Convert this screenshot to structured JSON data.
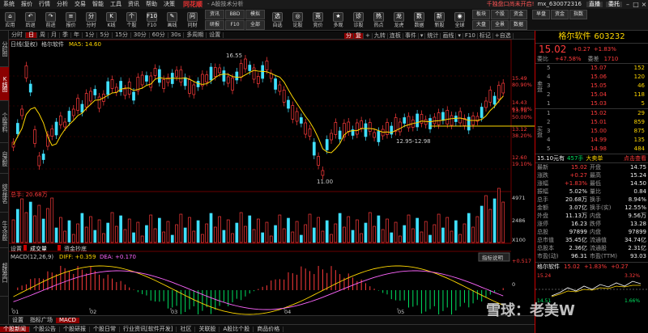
{
  "menubar": {
    "items": [
      "系统",
      "报价",
      "行情",
      "分析",
      "交易",
      "智能",
      "工具",
      "资讯",
      "帮助",
      "决策"
    ],
    "logo": "同花顺",
    "title": "- A股技术分析",
    "promo": "千独盘口尚未开启!",
    "account": "mx_630072316",
    "live": "直播",
    "delegate": "委托"
  },
  "toolbar": {
    "items": [
      {
        "icon": "⌂",
        "label": "应用"
      },
      {
        "icon": "↶",
        "label": "后退"
      },
      {
        "icon": "↷",
        "label": "前进"
      },
      {
        "icon": "≡",
        "label": "报价"
      },
      {
        "icon": "分",
        "label": "分时"
      },
      {
        "icon": "K",
        "label": "K线"
      },
      {
        "icon": "个",
        "label": "个股"
      },
      {
        "icon": "F10",
        "label": "F10"
      },
      {
        "icon": "✎",
        "label": "画线"
      },
      {
        "icon": "问",
        "label": "问财"
      },
      {
        "icon": "选",
        "label": "自选"
      },
      {
        "icon": "◎",
        "label": "论股"
      },
      {
        "icon": "竞",
        "label": "竞价"
      },
      {
        "icon": "★",
        "label": "多观"
      },
      {
        "icon": "诊",
        "label": "诊股"
      },
      {
        "icon": "热",
        "label": "热点"
      },
      {
        "icon": "龙",
        "label": "龙虎"
      },
      {
        "icon": "数",
        "label": "数据"
      },
      {
        "icon": "新",
        "label": "新股"
      },
      {
        "icon": "◉",
        "label": "全球"
      }
    ],
    "small": [
      "资讯",
      "BBD",
      "模拟",
      "研报",
      "F10",
      "全部",
      "早盘",
      "资金",
      "指数"
    ],
    "extra": [
      "板块",
      "个股",
      "资金",
      "大盘",
      "全景",
      "数据"
    ]
  },
  "lefttabs": [
    "分时图",
    "K线图",
    "个股资料",
    "自选股",
    "综合排名",
    "牛叉诊股",
    "超级盘口"
  ],
  "periodbar": {
    "items": [
      "分时",
      "日",
      "周",
      "月",
      "季",
      "年",
      "1分",
      "5分",
      "15分",
      "30分",
      "60分",
      "30s",
      "多周期",
      "设置"
    ],
    "active": "日",
    "extra": [
      "分",
      "复",
      "+",
      "九转",
      "连板",
      "事件",
      "▾",
      "统计",
      "画线",
      "▾",
      "F10",
      "标记",
      "+自选"
    ]
  },
  "mainchart": {
    "label": "日线(复权)",
    "stock": "格尔软件",
    "ma": "MA5: 14.60",
    "price_labels": [
      "15.49",
      "14.43",
      "13.78",
      "13.12",
      "12.60"
    ],
    "pct_labels": [
      "80.90%",
      "61.80%",
      "50.00%",
      "38.20%",
      "19.10%"
    ],
    "annotations": {
      "high": "16.55",
      "low": "11.00",
      "range": "12.95-12.98"
    }
  },
  "volchart": {
    "label": "总手: 20.68万",
    "ticks": [
      "4971",
      "2486",
      "X100"
    ],
    "tabs": [
      "设置",
      "成交量",
      "资金抄底"
    ]
  },
  "macdchart": {
    "label": "MACD(12,26,9)",
    "diff": "DIFF: +0.359",
    "dea": "DEA: +0.170",
    "ticks": [
      "+0.517",
      "0",
      "-0.517"
    ],
    "button": "指标说明"
  },
  "xaxis": [
    "01",
    "02",
    "03",
    "04",
    "05"
  ],
  "subtabs": [
    "设置",
    "指标广场",
    "MACD"
  ],
  "bottomtabs": [
    "个股新闻",
    "个股公告",
    "个股研报",
    "个股日常",
    "行业资讯[软件开发]",
    "社区",
    "关联股",
    "A股比个股",
    "商品价格"
  ],
  "quote": {
    "name": "格尔软件",
    "code": "603232",
    "price": "15.02",
    "change": "+0.27",
    "pct": "+1.83%",
    "ratio_label": "委比",
    "ratio": "+47.58%",
    "diff_label": "委差",
    "diff": "1710",
    "asks": [
      {
        "lv": "5",
        "price": "15.07",
        "vol": "152"
      },
      {
        "lv": "4",
        "price": "15.06",
        "vol": "120"
      },
      {
        "lv": "3",
        "price": "15.05",
        "vol": "46"
      },
      {
        "lv": "2",
        "price": "15.04",
        "vol": "118"
      },
      {
        "lv": "1",
        "price": "15.03",
        "vol": "5"
      }
    ],
    "bids": [
      {
        "lv": "1",
        "price": "15.02",
        "vol": "29"
      },
      {
        "lv": "2",
        "price": "15.01",
        "vol": "859"
      },
      {
        "lv": "3",
        "price": "15.00",
        "vol": "875"
      },
      {
        "lv": "4",
        "price": "14.99",
        "vol": "135"
      },
      {
        "lv": "5",
        "price": "14.98",
        "vol": "484"
      }
    ],
    "ask_side": "卖盘",
    "bid_side": "买盘",
    "big": "15.10元有",
    "big_vol": "457手",
    "big_label": "大卖单",
    "commission_btn": "点击查看",
    "stats": [
      [
        "最新",
        "15.02",
        "开盘",
        "14.75"
      ],
      [
        "涨跌",
        "+0.27",
        "最高",
        "15.24"
      ],
      [
        "涨幅",
        "+1.83%",
        "最低",
        "14.50"
      ],
      [
        "振幅",
        "5.02%",
        "量比",
        "0.84"
      ],
      [
        "总手",
        "20.68万",
        "换手",
        "8.94%"
      ],
      [
        "金额",
        "3.07亿",
        "换手(实)",
        "12.55%"
      ],
      [
        "外盘",
        "11.13万",
        "内盘",
        "9.56万"
      ],
      [
        "涨停",
        "16.23",
        "跌停",
        "13.28"
      ],
      [
        "总股",
        "97899",
        "内盘",
        "97899"
      ],
      [
        "总市值",
        "35.45亿",
        "流通值",
        "34.74亿"
      ],
      [
        "总股本",
        "2.36亿",
        "流通股",
        "2.31亿"
      ],
      [
        "市盈(动)",
        "96.31",
        "市盈(TTM)",
        "93.03"
      ]
    ],
    "mini": {
      "name": "格尔软件",
      "price": "15.02",
      "pct": "+1.83%",
      "chg": "+0.27",
      "hi": "15.24",
      "lo": "14.51",
      "hpct": "3.32%",
      "lpct": "1.66%"
    }
  },
  "watermark": "雪球：老美W"
}
